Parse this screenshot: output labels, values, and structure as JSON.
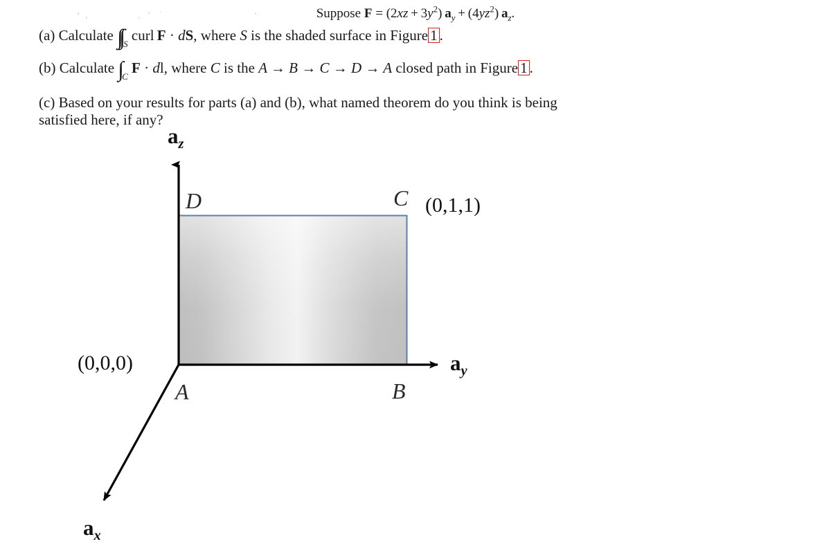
{
  "document": {
    "prompt": {
      "lead": "Suppose",
      "field_symbol": "F",
      "equals": "=",
      "component_y": "(2xz + 3y²) a_y",
      "component_z": "(4yz²) a_z",
      "full_text": "Suppose F = (2xz + 3y²) a_y + (4yz²) a_z."
    },
    "parts": [
      {
        "label": "(a)",
        "text": "Calculate ∬_S curl F · dS, where S is the shaded surface in Figure 1.",
        "verb": "Calculate",
        "integral": "∬",
        "integral_sub": "S",
        "integrand": "curl F · dS",
        "clause": ", where",
        "domain_symbol": "S",
        "tail": "is the shaded surface in Figure",
        "figure_ref": "1",
        "period": "."
      },
      {
        "label": "(b)",
        "text": "Calculate ∫_C F · dl, where C is the A → B → C → D → A closed path in Figure 1.",
        "verb": "Calculate",
        "integral": "∫",
        "integral_sub": "C",
        "integrand": "F · dl",
        "clause": ", where",
        "domain_symbol": "C",
        "tail_pre": "is the",
        "path": "A → B → C → D → A",
        "tail_post": "closed path in Figure",
        "figure_ref": "1",
        "period": "."
      },
      {
        "label": "(c)",
        "text": "Based on your results for parts (a) and (b), what named theorem do you think is being satisfied here, if any?",
        "line1": "Based on your results for parts (a) and (b), what named theorem do you think is",
        "line2": "being satisfied here, if any?"
      }
    ]
  },
  "figure": {
    "caption": "",
    "axes": [
      {
        "name": "z-axis",
        "label_base": "a",
        "label_sub": "z",
        "direction": "up"
      },
      {
        "name": "y-axis",
        "label_base": "a",
        "label_sub": "y",
        "direction": "right"
      },
      {
        "name": "x-axis",
        "label_base": "a",
        "label_sub": "x",
        "direction": "lower-left"
      }
    ],
    "vertices": [
      {
        "name": "A",
        "label": "A",
        "coordinate": "(0,0,0)"
      },
      {
        "name": "B",
        "label": "B",
        "coordinate": ""
      },
      {
        "name": "C",
        "label": "C",
        "coordinate": "(0,1,1)"
      },
      {
        "name": "D",
        "label": "D",
        "coordinate": ""
      }
    ],
    "surface": {
      "name": "shaded-surface",
      "border_color": "#5b7fa6",
      "gradient_edge_color": "#bfbfbf",
      "gradient_center_color": "#fbfbfb"
    },
    "axis_color": "#000000"
  }
}
